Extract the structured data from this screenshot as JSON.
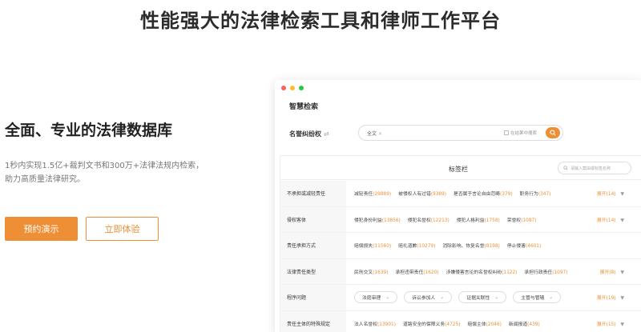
{
  "headline": "性能强大的法律检索工具和律师工作平台",
  "left": {
    "title": "全面、专业的法律数据库",
    "desc": "1秒内实现1.5亿+裁判文书和300万+法律法规内检索，助力高质量法律研究。",
    "primary_btn": "预约演示",
    "secondary_btn": "立即体验"
  },
  "colors": {
    "accent": "#ee8f35",
    "dot_red": "#ff5f56",
    "dot_yellow": "#ffbd2e",
    "dot_green": "#27c93f"
  },
  "window": {
    "title": "智慧检索",
    "search": {
      "field_label": "名誉纠纷权",
      "swap_icon": "⇄",
      "scope": "全文",
      "scope_close": "×",
      "in_result": "在结果中搜索"
    },
    "tags": {
      "title": "标签栏",
      "search_placeholder": "请输入案由或标签名称",
      "rows": [
        {
          "label": "不承担或减轻责任",
          "items": [
            {
              "name": "减轻责任",
              "count": "(29889)"
            },
            {
              "name": "被侵权人有过错",
              "count": "(9389)"
            },
            {
              "name": "是否属于言论自由范畴",
              "count": "(379)"
            },
            {
              "name": "职务行为",
              "count": "(347)"
            }
          ],
          "expand": "展开",
          "expand_count": "(14)"
        },
        {
          "label": "侵权客体",
          "items": [
            {
              "name": "侵犯身份利益",
              "count": "(13856)"
            },
            {
              "name": "侵犯名誉权",
              "count": "(12213)"
            },
            {
              "name": "侵犯人格利益",
              "count": "(1758)"
            },
            {
              "name": "荣誉权",
              "count": "(1087)"
            }
          ],
          "expand": "展开",
          "expand_count": "(14)"
        },
        {
          "label": "责任承担方式",
          "items": [
            {
              "name": "赔偿损失",
              "count": "(11560)"
            },
            {
              "name": "赔礼道歉",
              "count": "(10279)"
            },
            {
              "name": "消除影响、恢复名誉",
              "count": "(8198)"
            },
            {
              "name": "停止侵害",
              "count": "(4601)"
            }
          ],
          "expand": "",
          "expand_count": ""
        },
        {
          "label": "法律责任类型",
          "items": [
            {
              "name": "民刑交叉",
              "count": "(1639)"
            },
            {
              "name": "承担违带责任",
              "count": "(1620)"
            },
            {
              "name": "涉嫌侵害言论的名誉权纠纷",
              "count": "(1122)"
            },
            {
              "name": "承担行政责任",
              "count": "(1097)"
            }
          ],
          "expand": "展开",
          "expand_count": "(8)"
        },
        {
          "label": "程序问题",
          "pills": [
            "法庭审理",
            "诉讼参加人",
            "证据关联性",
            "主管与管辖"
          ],
          "expand": "展开",
          "expand_count": "(19)"
        },
        {
          "label": "责任主体的特殊规定",
          "items": [
            {
              "name": "法人名誉权",
              "count": "(13901)"
            },
            {
              "name": "道路安全的保障义务",
              "count": "(4725)"
            },
            {
              "name": "赔偿主体",
              "count": "(2046)"
            },
            {
              "name": "新闻报道",
              "count": "(439)"
            }
          ],
          "expand": "展开",
          "expand_count": "(15)"
        }
      ]
    }
  }
}
